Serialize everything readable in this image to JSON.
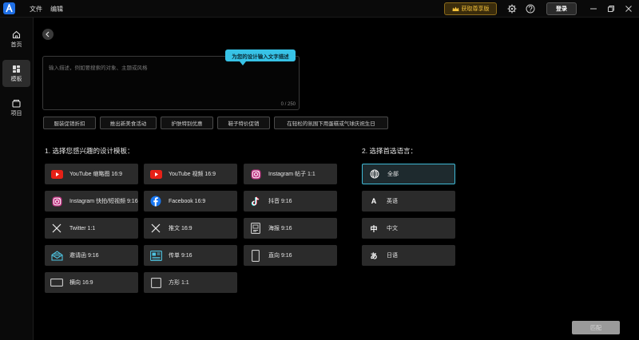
{
  "titlebar": {
    "menu": [
      "文件",
      "编辑"
    ],
    "vip_label": "获取尊享版",
    "login_label": "登录"
  },
  "sidebar": {
    "items": [
      {
        "label": "首页",
        "icon": "home-icon"
      },
      {
        "label": "模板",
        "icon": "template-icon"
      },
      {
        "label": "项目",
        "icon": "folder-icon"
      }
    ]
  },
  "prompt": {
    "placeholder": "输入描述，例如要搜索的对象、主题或风格",
    "counter": "0 / 250",
    "tooltip": "为您的设计输入文字描述"
  },
  "suggestions": [
    "服装促销折扣",
    "推出新美食活动",
    "护肤特别优惠",
    "鞋子特价促销",
    "在轻松的氛围下用蛋糕或气球庆祝生日"
  ],
  "templates_section": {
    "title": "1. 选择您感兴趣的设计模板：",
    "items": [
      {
        "label": "YouTube 缩略图 16:9",
        "icon": "youtube-icon"
      },
      {
        "label": "YouTube 视频 16:9",
        "icon": "youtube-icon"
      },
      {
        "label": "Instagram 帖子 1:1",
        "icon": "instagram-icon"
      },
      {
        "label": "Instagram 快拍/短视频 9:16",
        "icon": "instagram-icon"
      },
      {
        "label": "Facebook 16:9",
        "icon": "facebook-icon"
      },
      {
        "label": "抖音 9:16",
        "icon": "tiktok-icon"
      },
      {
        "label": "Twitter 1:1",
        "icon": "x-icon"
      },
      {
        "label": "推文 16:9",
        "icon": "x-icon"
      },
      {
        "label": "海报 9:16",
        "icon": "poster-icon"
      },
      {
        "label": "邀请函 9:16",
        "icon": "envelope-icon"
      },
      {
        "label": "传单 9:16",
        "icon": "flyer-icon"
      },
      {
        "label": "直向 9:16",
        "icon": "portrait-icon"
      },
      {
        "label": "横向 16:9",
        "icon": "landscape-icon"
      },
      {
        "label": "方形 1:1",
        "icon": "square-icon"
      }
    ]
  },
  "language_section": {
    "title": "2. 选择首选语言：",
    "items": [
      {
        "label": "全部",
        "glyph": ""
      },
      {
        "label": "英语",
        "glyph": "A"
      },
      {
        "label": "中文",
        "glyph": "中"
      },
      {
        "label": "日语",
        "glyph": "あ"
      }
    ]
  },
  "match_label": "匹配",
  "colors": {
    "accent": "#37c2e6",
    "vip": "#f3c13a",
    "youtube": "#e62117",
    "facebook": "#1877f2"
  }
}
